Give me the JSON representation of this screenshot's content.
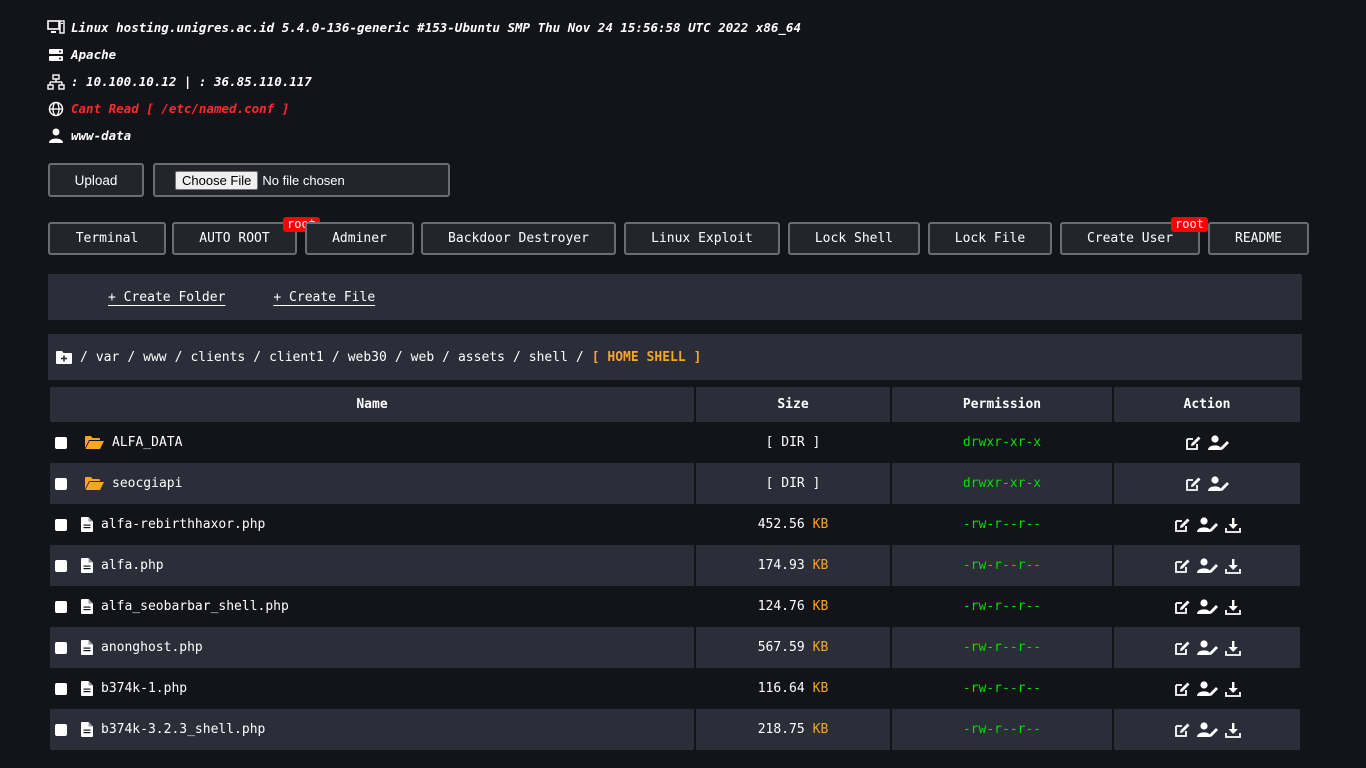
{
  "info": {
    "system": "Linux hosting.unigres.ac.id 5.4.0-136-generic #153-Ubuntu SMP Thu Nov 24 15:56:58 UTC 2022 x86_64",
    "server": "Apache",
    "ip": ": 10.100.10.12 | : 36.85.110.117",
    "domains": "Cant Read [ /etc/named.conf ]",
    "user": "www-data"
  },
  "upload": {
    "button": "Upload",
    "choose": "Choose File",
    "no_file": "No file chosen"
  },
  "tools": [
    {
      "label": "Terminal"
    },
    {
      "label": "AUTO ROOT",
      "badge": "root"
    },
    {
      "label": "Adminer"
    },
    {
      "label": "Backdoor Destroyer"
    },
    {
      "label": "Linux Exploit"
    },
    {
      "label": "Lock Shell"
    },
    {
      "label": "Lock File"
    },
    {
      "label": "Create User",
      "badge": "root"
    },
    {
      "label": "README"
    }
  ],
  "create": {
    "folder": "+ Create Folder",
    "file": "+ Create File"
  },
  "path": {
    "segments": [
      "var",
      "www",
      "clients",
      "client1",
      "web30",
      "web",
      "assets",
      "shell"
    ],
    "separator": "/",
    "home": "[ HOME SHELL ]"
  },
  "table": {
    "headers": [
      "Name",
      "Size",
      "Permission",
      "Action"
    ],
    "rows": [
      {
        "name": "ALFA_DATA",
        "type": "dir",
        "size": "[ DIR ]",
        "unit": "",
        "perm": "drwxr-xr-x"
      },
      {
        "name": "seocgiapi",
        "type": "dir",
        "size": "[ DIR ]",
        "unit": "",
        "perm": "drwxr-xr-x"
      },
      {
        "name": "alfa-rebirthhaxor.php",
        "type": "file",
        "size": "452.56",
        "unit": "KB",
        "perm": "-rw-r--r--"
      },
      {
        "name": "alfa.php",
        "type": "file",
        "size": "174.93",
        "unit": "KB",
        "perm": "-rw-r--r--"
      },
      {
        "name": "alfa_seobarbar_shell.php",
        "type": "file",
        "size": "124.76",
        "unit": "KB",
        "perm": "-rw-r--r--"
      },
      {
        "name": "anonghost.php",
        "type": "file",
        "size": "567.59",
        "unit": "KB",
        "perm": "-rw-r--r--"
      },
      {
        "name": "b374k-1.php",
        "type": "file",
        "size": "116.64",
        "unit": "KB",
        "perm": "-rw-r--r--"
      },
      {
        "name": "b374k-3.2.3_shell.php",
        "type": "file",
        "size": "218.75",
        "unit": "KB",
        "perm": "-rw-r--r--"
      }
    ]
  },
  "colors": {
    "background": "#13141a",
    "panel": "#2b2d38",
    "accent": "#f5a623",
    "permission": "#00e000",
    "badge": "#ff0000",
    "error": "#ff2a2a"
  }
}
